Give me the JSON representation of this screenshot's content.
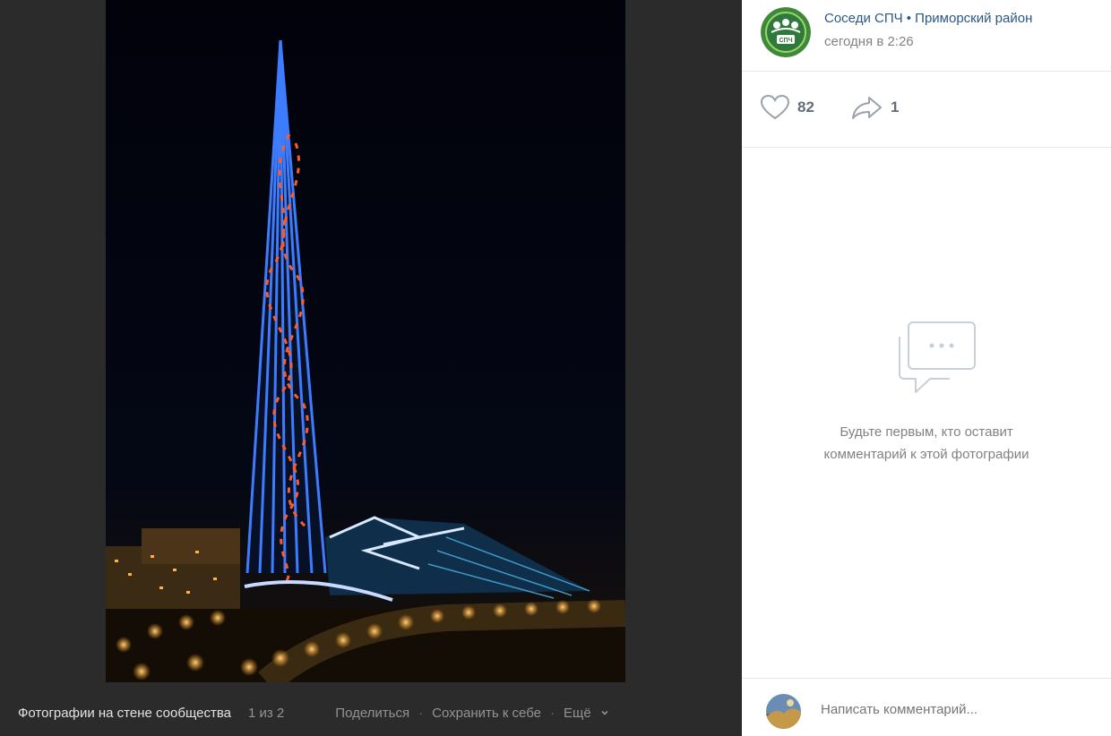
{
  "group": {
    "name": "Соседи СПЧ • Приморский район",
    "time": "сегодня в 2:26",
    "avatar_text": "СПЧ"
  },
  "reactions": {
    "likes": "82",
    "shares": "1"
  },
  "comments": {
    "empty_line1": "Будьте первым, кто оставит",
    "empty_line2": "комментарий к этой фотографии",
    "placeholder": "Написать комментарий..."
  },
  "footer": {
    "album": "Фотографии на стене сообщества",
    "counter": "1 из 2",
    "share": "Поделиться",
    "save": "Сохранить к себе",
    "more": "Ещё"
  },
  "photo": {
    "subject": "night-skyscraper-photo"
  },
  "colors": {
    "link": "#2a5885",
    "muted": "#828282",
    "viewer_bg": "#2b2b2b",
    "accent_green": "#6aa84f"
  },
  "icons": {
    "like": "heart-icon",
    "share": "share-arrow-icon",
    "empty": "comments-bubble-icon",
    "more": "chevron-down-icon"
  }
}
